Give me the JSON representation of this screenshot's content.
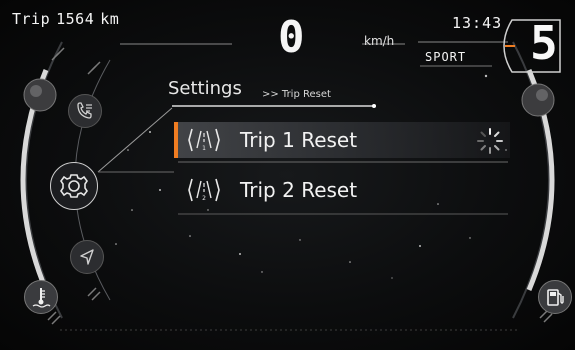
{
  "trip": {
    "label": "Trip",
    "distance": "1564",
    "unit": "km"
  },
  "clock": "13:43",
  "speed": {
    "value": "0",
    "unit": "km/h"
  },
  "drive_mode": "SPORT",
  "gear": "5",
  "menu": {
    "title": "Settings",
    "breadcrumb": ">> Trip Reset",
    "items": [
      {
        "label": "Trip 1 Reset",
        "icon": "road-trip-1-icon",
        "selected": true,
        "busy": true
      },
      {
        "label": "Trip 2 Reset",
        "icon": "road-trip-2-icon",
        "selected": false
      }
    ]
  },
  "nav_icons": [
    "phone-icon",
    "settings-gear-icon",
    "navigation-icon"
  ],
  "gauge_icons": {
    "left": "coolant-temperature-icon",
    "right": "fuel-pump-icon"
  },
  "colors": {
    "accent": "#f07d22",
    "text": "#f2f2f2",
    "background": "#0c0d0e"
  }
}
